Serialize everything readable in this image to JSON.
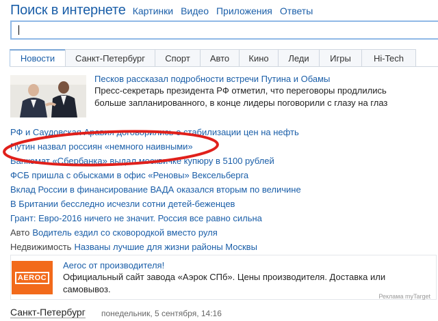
{
  "header": {
    "title": "Поиск в интернете",
    "nav": [
      "Картинки",
      "Видео",
      "Приложения",
      "Ответы"
    ]
  },
  "search": {
    "value": "",
    "placeholder": ""
  },
  "tabs": [
    {
      "label": "Новости",
      "active": true
    },
    {
      "label": "Санкт-Петербург"
    },
    {
      "label": "Спорт"
    },
    {
      "label": "Авто"
    },
    {
      "label": "Кино"
    },
    {
      "label": "Леди"
    },
    {
      "label": "Игры"
    },
    {
      "label": "Hi-Tech"
    }
  ],
  "lead": {
    "title": "Песков рассказал подробности встречи Путина и Обамы",
    "text": "Пресс-секретарь президента РФ отметил, что переговоры продлились больше запланированного, в конце лидеры поговорили с глазу на глаз"
  },
  "news": [
    {
      "category": "",
      "title": "РФ и Саудовская Аравия договорились о стабилизации цен на нефть"
    },
    {
      "category": "",
      "title": "Путин назвал россиян «немного наивными»"
    },
    {
      "category": "",
      "title": "Банкомат «Сбербанка» выдал москвичке купюру в 5100 рублей"
    },
    {
      "category": "",
      "title": "ФСБ пришла с обысками в офис «Реновы» Вексельберга"
    },
    {
      "category": "",
      "title": "Вклад России в финансирование ВАДА оказался вторым по величине"
    },
    {
      "category": "",
      "title": "В Британии бесследно исчезли сотни детей-беженцев"
    },
    {
      "category": "",
      "title": "Грант: Евро-2016 ничего не значит. Россия все равно сильна"
    },
    {
      "category": "Авто",
      "title": "Водитель ездил со сковородкой вместо руля"
    },
    {
      "category": "Недвижимость",
      "title": "Названы лучшие для жизни районы Москвы"
    }
  ],
  "annotation_color": "#e0201b",
  "ad": {
    "logo_text": "AEROC",
    "logo_color": "#f26a1b",
    "title": "Aeroc от производителя!",
    "text": "Официальный сайт завода «Аэрок СПб». Цены производителя. Доставка или самовывоз.",
    "credit": "Реклама myTarget"
  },
  "footer": {
    "city": "Санкт-Петербург",
    "date": "понедельник, 5 сентября, 14:16"
  }
}
